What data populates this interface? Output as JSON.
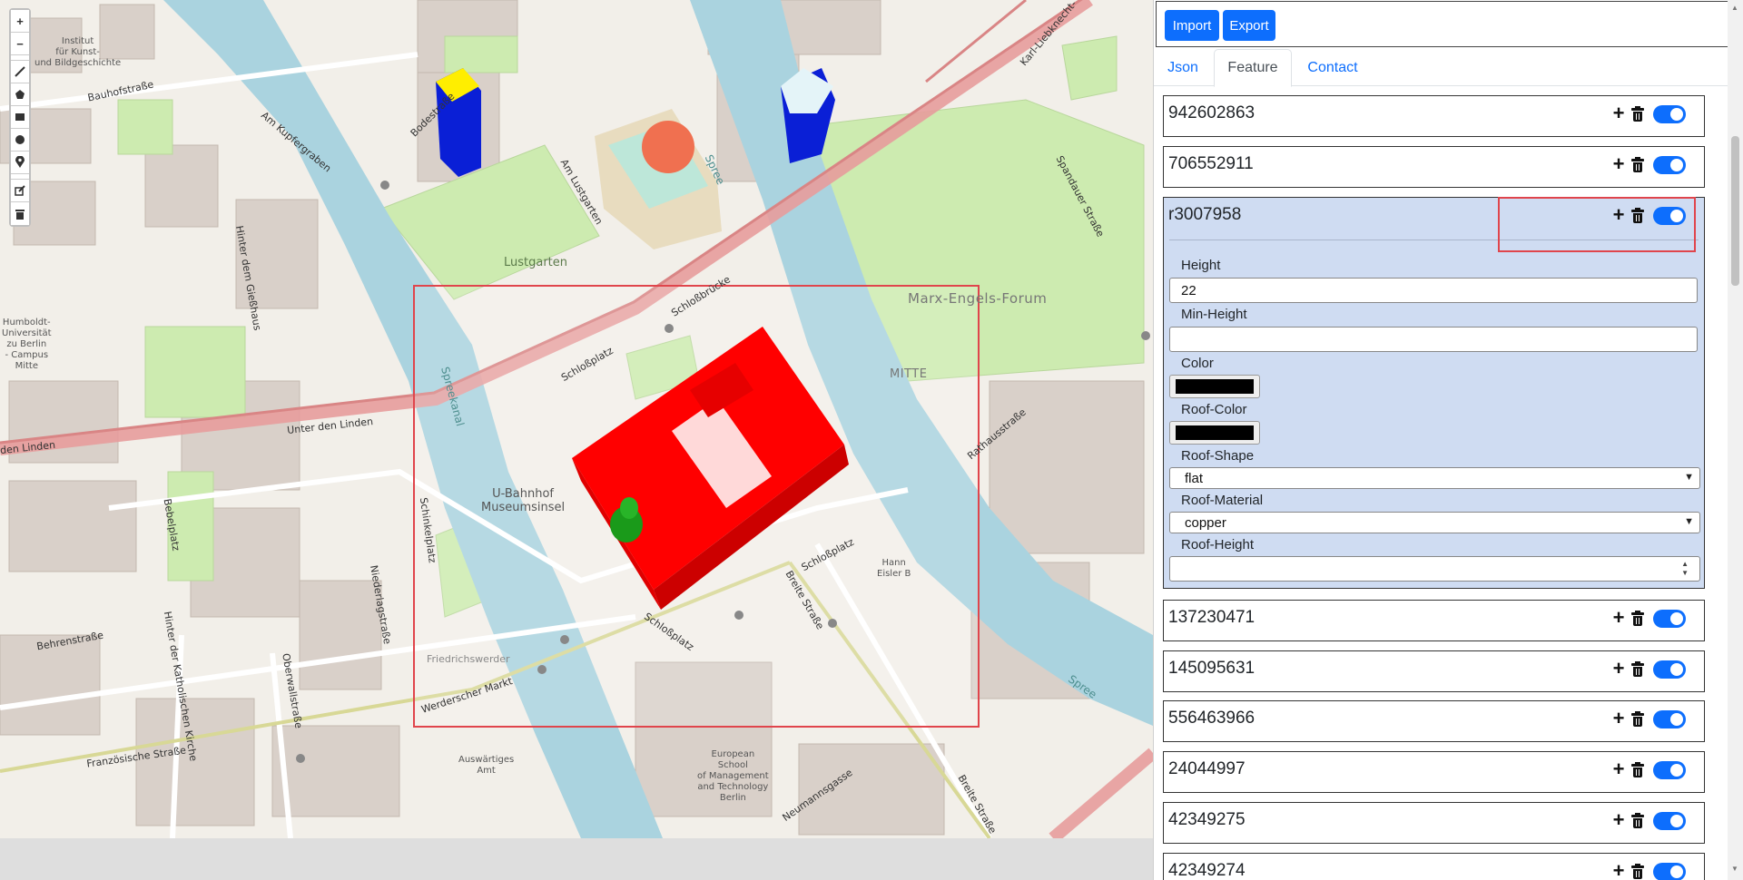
{
  "map": {
    "labels": {
      "institut": "Institut\nfür Kunst-\nund Bildgeschichte",
      "bauhofstrasse": "Bauhofstraße",
      "am_kupfergraben": "Am Kupfergraben",
      "bodestrasse": "Bodestraße",
      "am_lustgarten": "Am Lustgarten",
      "hinter_giesshaus": "Hinter dem Gießhaus",
      "lustgarten": "Lustgarten",
      "humboldt": "Humboldt-\nUniversität\nzu Berlin\n- Campus\nMitte",
      "schlossplatz1": "Schloßplatz",
      "schlossbrucke": "Schloßbrücke",
      "marx_engels": "Marx-Engels-Forum",
      "mitte": "MITTE",
      "unter_den_linden": "Unter den Linden",
      "unter_den_linden_left": "den Linden",
      "spree": "Spree",
      "spreekanal": "Spreekanal",
      "ubahnhof": "U-Bahnhof\nMuseumsinsel",
      "schinkelplatz": "Schinkelplatz",
      "bebelplatz": "Bebelplatz",
      "behrenstrasse": "Behrenstraße",
      "hinter_kath_kirche": "Hinter der Katholischen Kirche",
      "oberwallstrasse": "Oberwallstraße",
      "niederlagstrasse": "Niederlagstraße",
      "friedrichswerder": "Friedrichswerder",
      "werderscher_markt": "Werderscher Markt",
      "franzoesische": "Französische Straße",
      "schlossplatz2": "Schloßplatz",
      "schlossplatz3": "Schloßplatz",
      "breite_strasse": "Breite Straße",
      "breite_strasse2": "Breite Straße",
      "auswaertiges": "Auswärtiges\nAmt",
      "esmt": "European\nSchool\nof Management\nand Technology\nBerlin",
      "neumannsgasse": "Neumannsgasse",
      "rathausstrasse": "Rathausstraße",
      "spandauer": "Spandauer Straße",
      "karl_liebknecht": "Karl-Liebknecht-",
      "spree2": "Spree",
      "hann_eisler": "Hann\nEisler B"
    },
    "tools": {
      "zoom_in": "+",
      "zoom_out": "−"
    },
    "colors": {
      "building_selected": "#ff0000",
      "tower_yellow": "#ffee00",
      "tower_blue": "#0a1fd6",
      "dome_orange": "#f07050",
      "tree_green": "#1a9a1a",
      "water": "#aad3df"
    }
  },
  "sidebar": {
    "import_label": "Import",
    "export_label": "Export",
    "tabs": {
      "json": "Json",
      "feature": "Feature",
      "contact": "Contact"
    },
    "features": [
      {
        "id": "942602863"
      },
      {
        "id": "706552911"
      },
      {
        "id": "r3007958"
      },
      {
        "id": "137230471"
      },
      {
        "id": "145095631"
      },
      {
        "id": "556463966"
      },
      {
        "id": "24044997"
      },
      {
        "id": "42349275"
      },
      {
        "id": "42349274"
      }
    ],
    "expanded": {
      "height_label": "Height",
      "height_value": "22",
      "min_height_label": "Min-Height",
      "min_height_value": "",
      "color_label": "Color",
      "color_value": "#000000",
      "roof_color_label": "Roof-Color",
      "roof_color_value": "#000000",
      "roof_shape_label": "Roof-Shape",
      "roof_shape_value": "flat",
      "roof_material_label": "Roof-Material",
      "roof_material_value": "copper",
      "roof_height_label": "Roof-Height",
      "roof_height_value": ""
    },
    "accent_color": "#0d6efd",
    "expanded_bg": "#cfdcf2",
    "highlight_color": "#e0454c"
  }
}
